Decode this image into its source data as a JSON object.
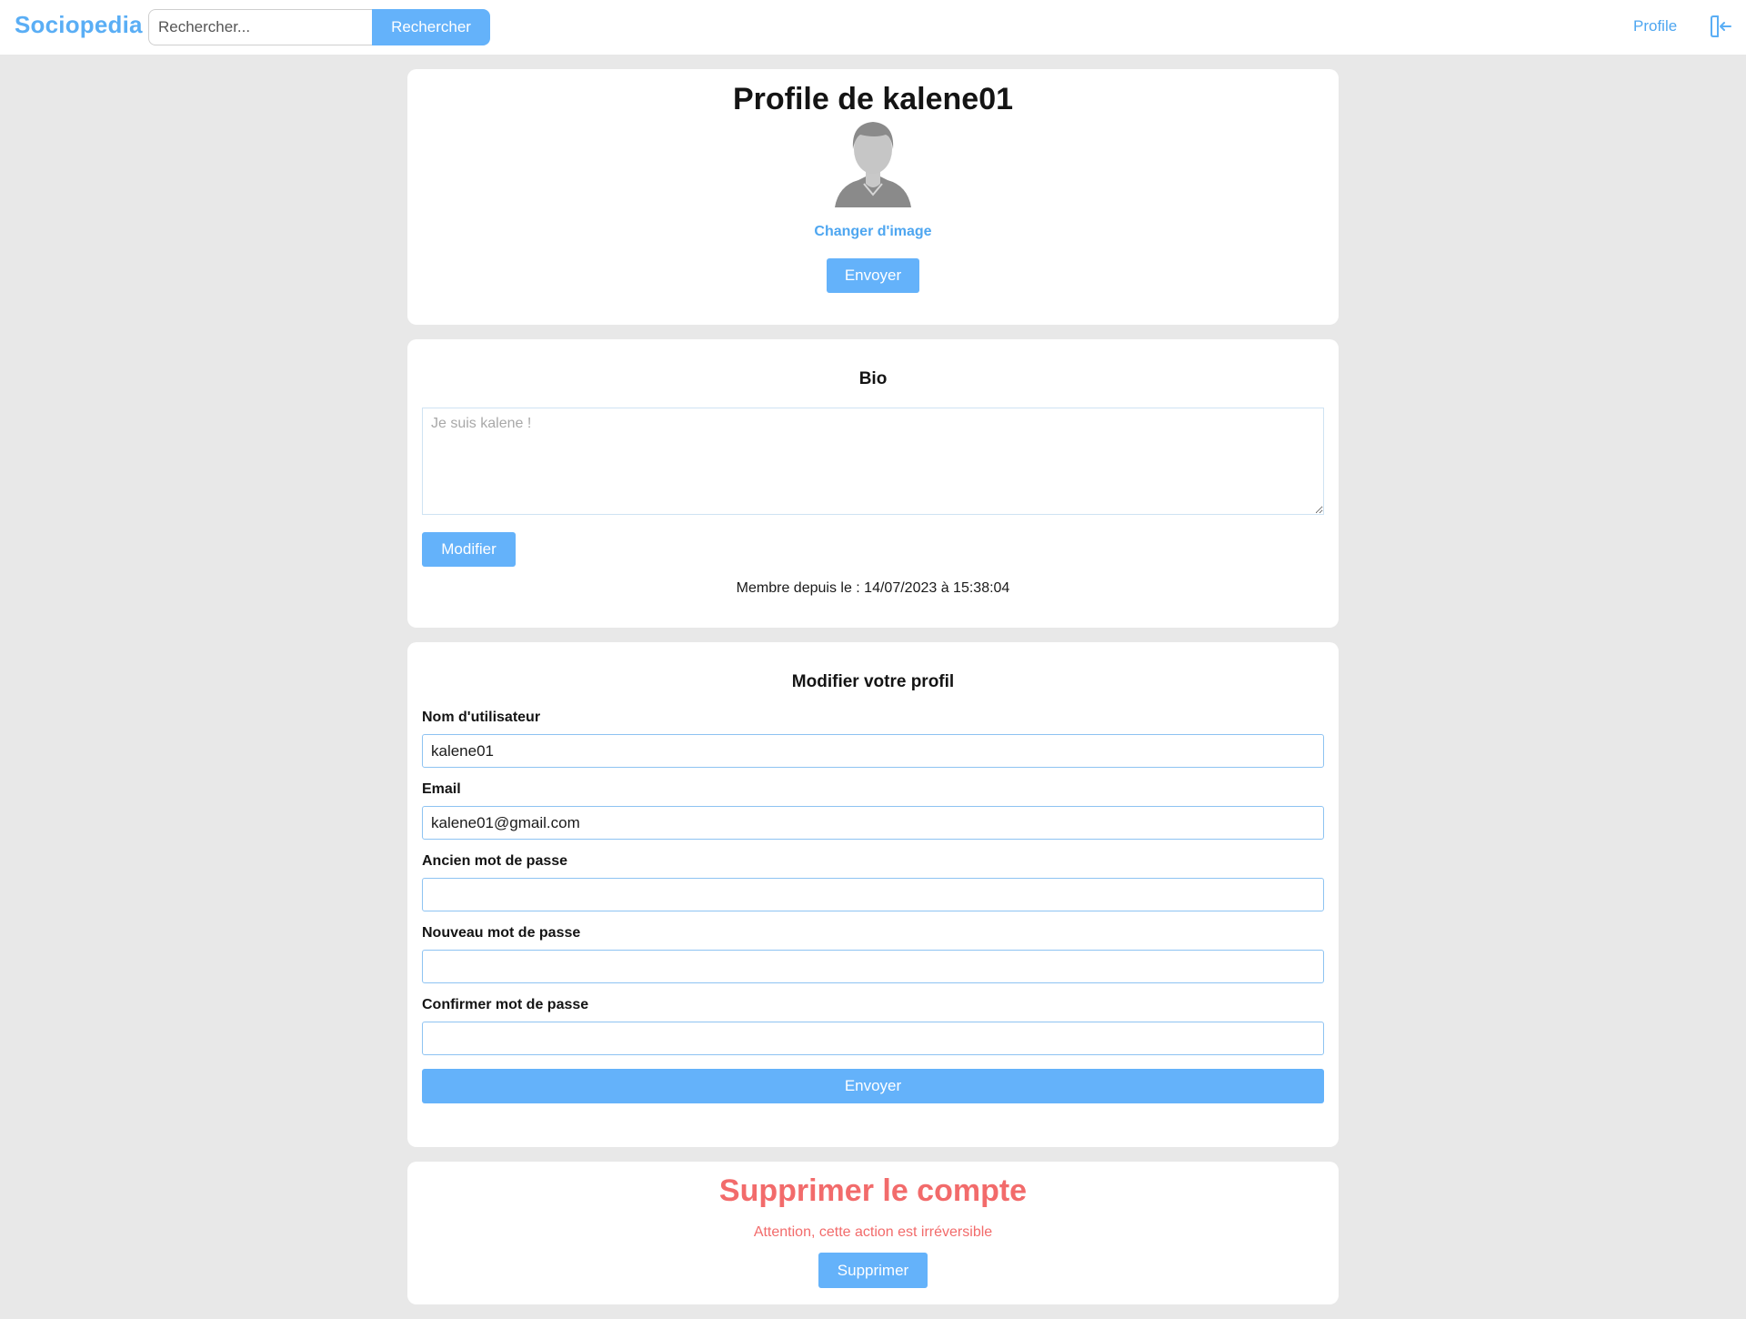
{
  "navbar": {
    "brand": "Sociopedia",
    "search_placeholder": "Rechercher...",
    "search_button": "Rechercher",
    "profile_link": "Profile",
    "logout_icon": "logout-icon"
  },
  "profile_card": {
    "title": "Profile de kalene01",
    "avatar_icon": "default-avatar-icon",
    "change_image": "Changer d'image",
    "send_button": "Envoyer"
  },
  "bio_card": {
    "title": "Bio",
    "bio_placeholder": "Je suis kalene !",
    "modify_button": "Modifier",
    "member_since": "Membre depuis le : 14/07/2023 à 15:38:04"
  },
  "edit_card": {
    "title": "Modifier votre profil",
    "fields": [
      {
        "label": "Nom d'utilisateur",
        "value": ""
      },
      {
        "label": "Email",
        "value": ""
      },
      {
        "label": "Ancien mot de passe",
        "value": ""
      },
      {
        "label": "Nouveau mot de passe",
        "value": ""
      },
      {
        "label": "Confirmer mot de passe",
        "value": ""
      }
    ],
    "username_value": "kalene01",
    "email_value": "kalene01@gmail.com",
    "send_button": "Envoyer"
  },
  "delete_card": {
    "title": "Supprimer le compte",
    "warning": "Attention, cette action est irréversible",
    "delete_button": "Supprimer"
  },
  "colors": {
    "accent": "#64b2fa",
    "brand": "#5aaef5",
    "danger": "#f26b6b",
    "background": "#e8e8e8"
  }
}
